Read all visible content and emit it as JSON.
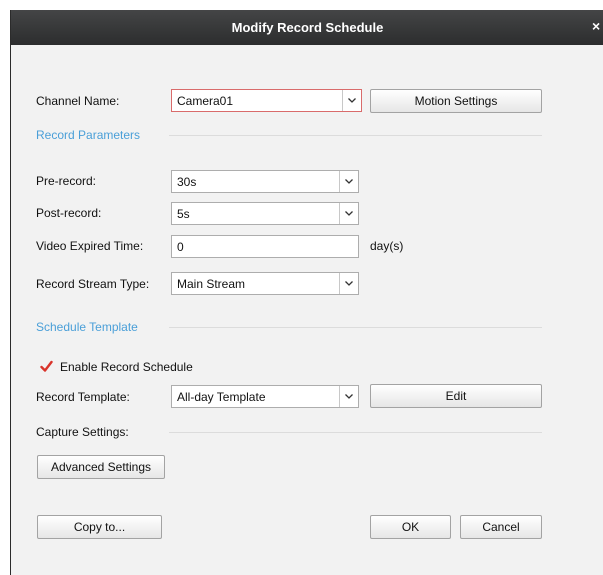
{
  "dialog": {
    "title": "Modify Record Schedule"
  },
  "channel": {
    "label": "Channel Name:",
    "value": "Camera01",
    "motion_button": "Motion Settings"
  },
  "record_parameters": {
    "section_label": "Record Parameters",
    "pre_record": {
      "label": "Pre-record:",
      "value": "30s"
    },
    "post_record": {
      "label": "Post-record:",
      "value": "5s"
    },
    "video_expired": {
      "label": "Video Expired Time:",
      "value": "0",
      "unit": "day(s)"
    },
    "stream_type": {
      "label": "Record Stream Type:",
      "value": "Main Stream"
    }
  },
  "schedule_template": {
    "section_label": "Schedule Template",
    "enable_label": "Enable Record Schedule",
    "enable_checked": true,
    "template": {
      "label": "Record Template:",
      "value": "All-day Template"
    },
    "edit_button": "Edit",
    "capture_label": "Capture Settings:",
    "advanced_button": "Advanced Settings"
  },
  "footer": {
    "copy_button": "Copy to...",
    "ok_button": "OK",
    "cancel_button": "Cancel"
  },
  "colors": {
    "section": "#4a9fd8",
    "check": "#d9342b",
    "focus_border": "#d96b6b",
    "titlebar": "#333435"
  }
}
